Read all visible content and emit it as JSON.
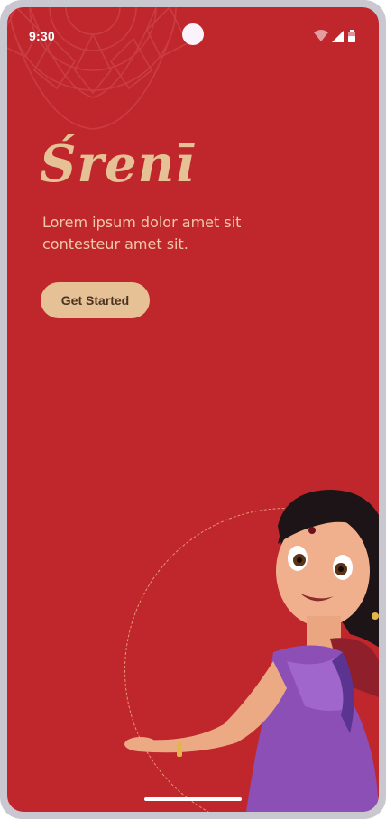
{
  "status_bar": {
    "time": "9:30",
    "icons": [
      "wifi-icon",
      "cellular-signal-icon",
      "battery-icon"
    ]
  },
  "welcome": {
    "brand": "Śrenī",
    "tagline": "Lorem ipsum dolor amet sit contesteur amet sit.",
    "cta_label": "Get Started"
  },
  "colors": {
    "background": "#c0272d",
    "brand_accent": "#e7c196",
    "tagline": "#f1c9a4",
    "button_text": "#4a3322",
    "frame": "#c9c8d0"
  },
  "illustration": {
    "subject": "cartoon-girl-in-purple-saree",
    "decorations": [
      "mandala-pattern",
      "dashed-circle"
    ]
  }
}
